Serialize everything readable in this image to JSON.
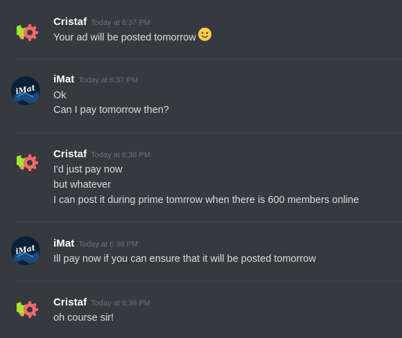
{
  "messages": [
    {
      "author": "Cristaf",
      "time": "Today at 6:37 PM",
      "avatar": "gear-logo",
      "lines": [
        "Your ad will be posted tomorrow"
      ],
      "emoji": "slightly-smiling-face"
    },
    {
      "author": "iMat",
      "time": "Today at 6:37 PM",
      "avatar": "imat-logo",
      "lines": [
        "Ok",
        "Can I pay tomorrow then?"
      ]
    },
    {
      "author": "Cristaf",
      "time": "Today at 6:38 PM",
      "avatar": "gear-logo",
      "lines": [
        "I'd just pay now",
        "but whatever",
        "I can post it during prime tomrrow when there is 600 members online"
      ]
    },
    {
      "author": "iMat",
      "time": "Today at 6:38 PM",
      "avatar": "imat-logo",
      "lines": [
        "Ill pay now if you can ensure that it will be posted tomorrow"
      ]
    },
    {
      "author": "Cristaf",
      "time": "Today at 6:38 PM",
      "avatar": "gear-logo",
      "lines": [
        "oh course sir!"
      ]
    }
  ],
  "avatar_logo_text": "iMat",
  "colors": {
    "background": "#36393e",
    "divider": "#40444a",
    "username": "#ffffff",
    "timestamp": "#6e7178",
    "message_text": "#dcddde",
    "gear_green": "#a6e22e",
    "gear_pink": "#f06a6a",
    "gear_orange": "#f5a25d",
    "imat_bg": "#0d2038",
    "imat_accent": "#3aa0ff"
  }
}
